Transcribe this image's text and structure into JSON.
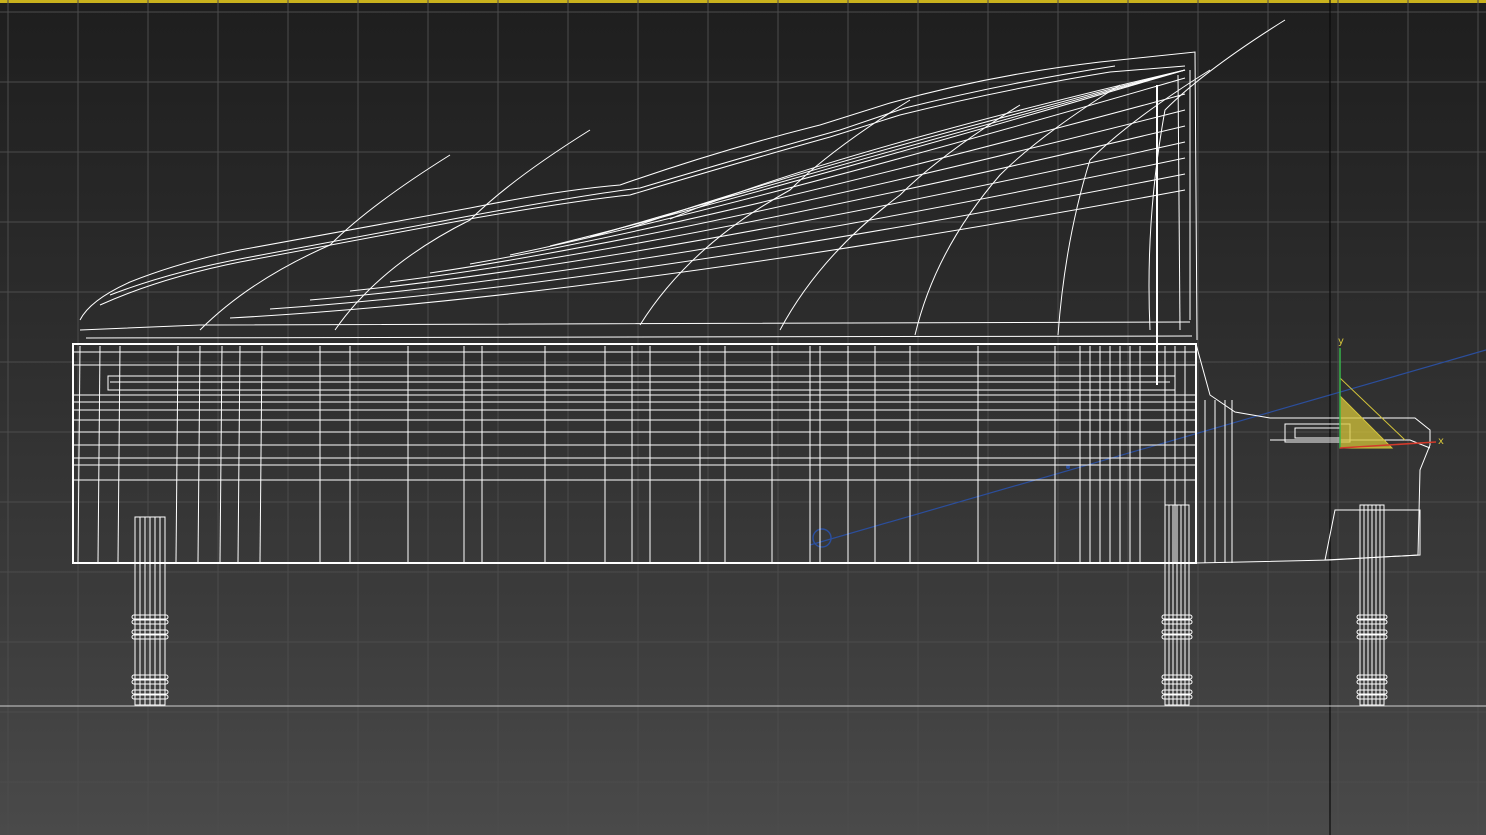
{
  "viewport": {
    "view": "Front",
    "shading": "Wireframe",
    "border_color": "#c9b21d",
    "background_top": "#1e1e1e",
    "background_bottom": "#4a4a4a"
  },
  "gizmo": {
    "x_label": "x",
    "y_label": "y",
    "x_color": "#d33a2b",
    "y_color": "#37b44a",
    "plane_color": "#d4c43a"
  },
  "object": {
    "type": "grand-piano-wireframe",
    "wire_color": "#ffffff",
    "camera_target_line_color": "#2b4e9c"
  }
}
